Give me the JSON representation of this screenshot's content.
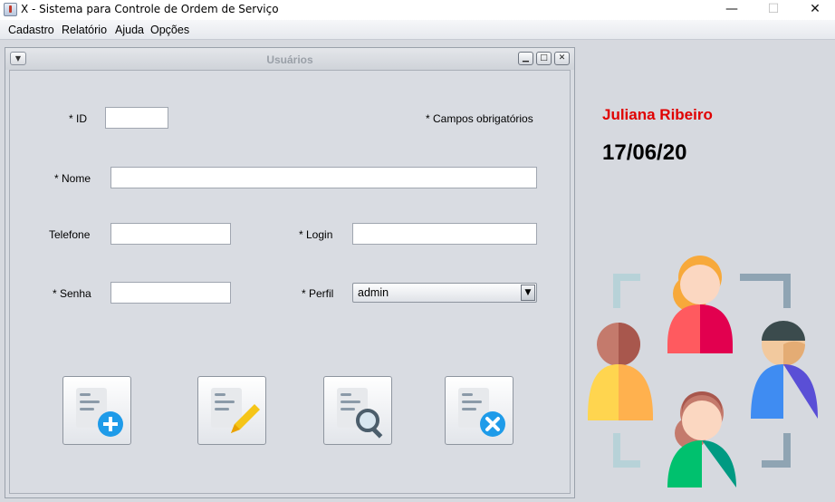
{
  "window": {
    "title": "X - Sistema para Controle de Ordem de Serviço",
    "min_glyph": "—",
    "max_glyph": "☐",
    "close_glyph": "✕"
  },
  "menu": {
    "cadastro": "Cadastro",
    "relatorio": "Relatório",
    "ajuda": "Ajuda",
    "opcoes": "Opções"
  },
  "frame": {
    "title": "Usuários",
    "required_note": "* Campos obrigatórios",
    "fields": {
      "id": {
        "label": "* ID",
        "value": ""
      },
      "nome": {
        "label": "* Nome",
        "value": ""
      },
      "telefone": {
        "label": "Telefone",
        "value": ""
      },
      "login": {
        "label": "* Login",
        "value": ""
      },
      "senha": {
        "label": "* Senha",
        "value": ""
      },
      "perfil": {
        "label": "* Perfil",
        "value": "admin"
      }
    },
    "buttons": {
      "add": "add-document-icon",
      "edit": "edit-document-icon",
      "search": "search-document-icon",
      "delete": "delete-document-icon"
    }
  },
  "sidebar": {
    "user_name": "Juliana Ribeiro",
    "date": "17/06/20",
    "colors": {
      "user_name": "#e00000"
    }
  }
}
